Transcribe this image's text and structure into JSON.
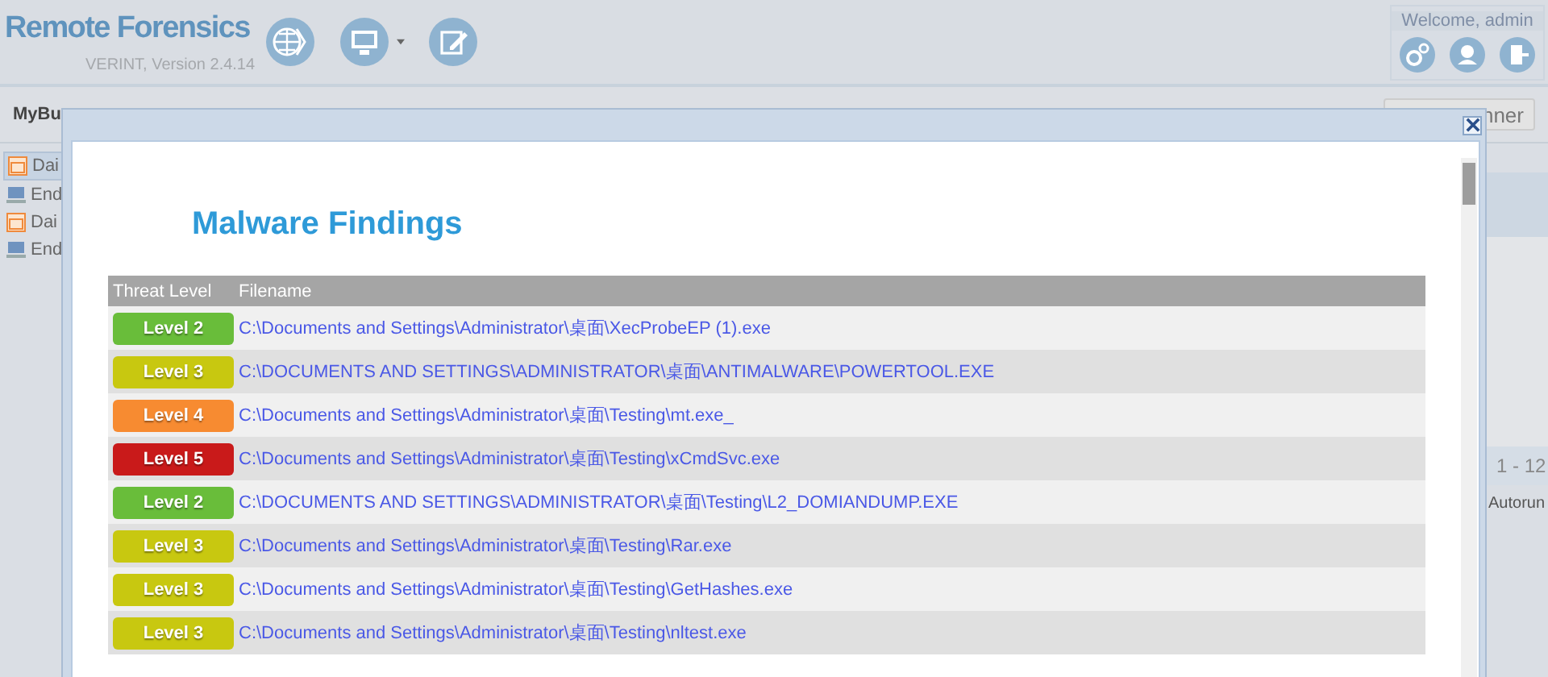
{
  "app": {
    "title": "Remote Forensics",
    "version": "VERINT, Version 2.4.14",
    "welcome": "Welcome, admin"
  },
  "toolbar": {
    "label": "MyBu",
    "button": "nner"
  },
  "sidebar": {
    "items": [
      {
        "label": "Dai",
        "kind": "calendar",
        "selected": true
      },
      {
        "label": "End",
        "kind": "computer",
        "selected": false
      },
      {
        "label": "Dai",
        "kind": "calendar",
        "selected": false
      },
      {
        "label": "End",
        "kind": "computer",
        "selected": false
      }
    ]
  },
  "right_panel": {
    "pager": "1 - 12",
    "tab": "Autorun"
  },
  "dialog": {
    "title": "Malware Findings",
    "columns": [
      "Threat Level",
      "Filename"
    ],
    "rows": [
      {
        "level": "Level 2",
        "color": "#69bd3a",
        "filename": "C:\\Documents and Settings\\Administrator\\桌面\\XecProbeEP (1).exe"
      },
      {
        "level": "Level 3",
        "color": "#c8c810",
        "filename": "C:\\DOCUMENTS AND SETTINGS\\ADMINISTRATOR\\桌面\\ANTIMALWARE\\POWERTOOL.EXE"
      },
      {
        "level": "Level 4",
        "color": "#f78b31",
        "filename": "C:\\Documents and Settings\\Administrator\\桌面\\Testing\\mt.exe_"
      },
      {
        "level": "Level 5",
        "color": "#c91a1a",
        "filename": "C:\\Documents and Settings\\Administrator\\桌面\\Testing\\xCmdSvc.exe"
      },
      {
        "level": "Level 2",
        "color": "#69bd3a",
        "filename": "C:\\DOCUMENTS AND SETTINGS\\ADMINISTRATOR\\桌面\\Testing\\L2_DOMIANDUMP.EXE"
      },
      {
        "level": "Level 3",
        "color": "#c8c810",
        "filename": "C:\\Documents and Settings\\Administrator\\桌面\\Testing\\Rar.exe"
      },
      {
        "level": "Level 3",
        "color": "#c8c810",
        "filename": "C:\\Documents and Settings\\Administrator\\桌面\\Testing\\GetHashes.exe"
      },
      {
        "level": "Level 3",
        "color": "#c8c810",
        "filename": "C:\\Documents and Settings\\Administrator\\桌面\\Testing\\nltest.exe"
      }
    ]
  }
}
